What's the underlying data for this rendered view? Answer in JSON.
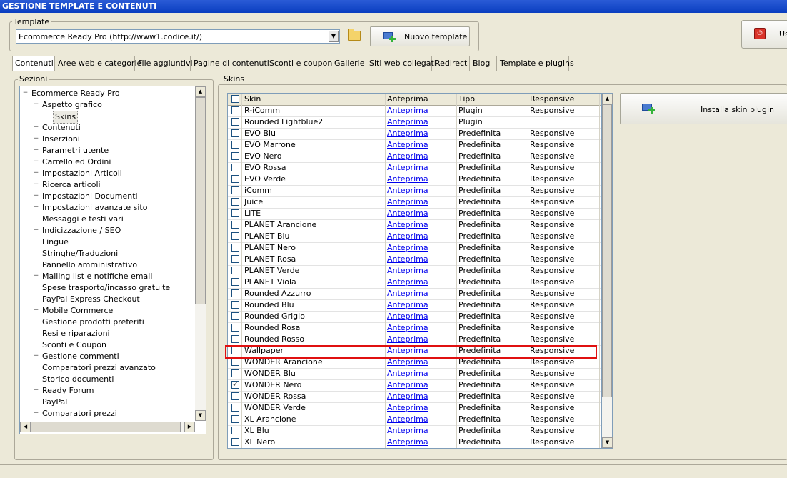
{
  "window": {
    "title": "GESTIONE TEMPLATE E CONTENUTI"
  },
  "template": {
    "group_label": "Template",
    "selected": "Ecommerce Ready Pro (http://www1.codice.it/)",
    "new_button": "Nuovo template"
  },
  "corner_button": "Us",
  "tabs": [
    "Contenuti",
    "Aree web e categorie",
    "File aggiuntivi",
    "Pagine di contenuti",
    "Sconti e coupon",
    "Gallerie",
    "Siti web collegati",
    "Redirect",
    "Blog",
    "Template e plugins"
  ],
  "sections": {
    "label": "Sezioni",
    "root": "Ecommerce Ready Pro",
    "items": [
      {
        "label": "Aspetto grafico",
        "level": 1,
        "expander": "−"
      },
      {
        "label": "Skins",
        "level": 2,
        "expander": ""
      },
      {
        "label": "Contenuti",
        "level": 1,
        "expander": "+"
      },
      {
        "label": "Inserzioni",
        "level": 1,
        "expander": "+"
      },
      {
        "label": "Parametri utente",
        "level": 1,
        "expander": "+"
      },
      {
        "label": "Carrello ed Ordini",
        "level": 1,
        "expander": "+"
      },
      {
        "label": "Impostazioni Articoli",
        "level": 1,
        "expander": "+"
      },
      {
        "label": "Ricerca articoli",
        "level": 1,
        "expander": "+"
      },
      {
        "label": "Impostazioni Documenti",
        "level": 1,
        "expander": "+"
      },
      {
        "label": "Impostazioni avanzate sito",
        "level": 1,
        "expander": "+"
      },
      {
        "label": "Messaggi e testi vari",
        "level": 1,
        "expander": ""
      },
      {
        "label": "Indicizzazione / SEO",
        "level": 1,
        "expander": "+"
      },
      {
        "label": "Lingue",
        "level": 1,
        "expander": ""
      },
      {
        "label": "Stringhe/Traduzioni",
        "level": 1,
        "expander": ""
      },
      {
        "label": "Pannello amministrativo",
        "level": 1,
        "expander": ""
      },
      {
        "label": "Mailing list e notifiche email",
        "level": 1,
        "expander": "+"
      },
      {
        "label": "Spese trasporto/incasso gratuite",
        "level": 1,
        "expander": ""
      },
      {
        "label": "PayPal Express Checkout",
        "level": 1,
        "expander": ""
      },
      {
        "label": "Mobile Commerce",
        "level": 1,
        "expander": "+"
      },
      {
        "label": "Gestione prodotti preferiti",
        "level": 1,
        "expander": ""
      },
      {
        "label": "Resi e riparazioni",
        "level": 1,
        "expander": ""
      },
      {
        "label": "Sconti e Coupon",
        "level": 1,
        "expander": ""
      },
      {
        "label": "Gestione commenti",
        "level": 1,
        "expander": "+"
      },
      {
        "label": "Comparatori prezzi avanzato",
        "level": 1,
        "expander": ""
      },
      {
        "label": "Storico documenti",
        "level": 1,
        "expander": ""
      },
      {
        "label": "Ready Forum",
        "level": 1,
        "expander": "+"
      },
      {
        "label": "PayPal",
        "level": 1,
        "expander": ""
      },
      {
        "label": "Comparatori prezzi",
        "level": 1,
        "expander": "+"
      }
    ]
  },
  "skins": {
    "label": "Skins",
    "columns": [
      "Skin",
      "Anteprima",
      "Tipo",
      "Responsive"
    ],
    "preview_link": "Anteprima",
    "install_button": "Installa skin plugin",
    "rows": [
      {
        "name": "R-iComm",
        "type": "Plugin",
        "responsive": "Responsive",
        "checked": false
      },
      {
        "name": "Rounded Lightblue2",
        "type": "Plugin",
        "responsive": "",
        "checked": false
      },
      {
        "name": "EVO Blu",
        "type": "Predefinita",
        "responsive": "Responsive",
        "checked": false
      },
      {
        "name": "EVO Marrone",
        "type": "Predefinita",
        "responsive": "Responsive",
        "checked": false
      },
      {
        "name": "EVO Nero",
        "type": "Predefinita",
        "responsive": "Responsive",
        "checked": false
      },
      {
        "name": "EVO Rossa",
        "type": "Predefinita",
        "responsive": "Responsive",
        "checked": false
      },
      {
        "name": "EVO Verde",
        "type": "Predefinita",
        "responsive": "Responsive",
        "checked": false
      },
      {
        "name": "iComm",
        "type": "Predefinita",
        "responsive": "Responsive",
        "checked": false
      },
      {
        "name": "Juice",
        "type": "Predefinita",
        "responsive": "Responsive",
        "checked": false
      },
      {
        "name": "LITE",
        "type": "Predefinita",
        "responsive": "Responsive",
        "checked": false
      },
      {
        "name": "PLANET Arancione",
        "type": "Predefinita",
        "responsive": "Responsive",
        "checked": false
      },
      {
        "name": "PLANET Blu",
        "type": "Predefinita",
        "responsive": "Responsive",
        "checked": false
      },
      {
        "name": "PLANET Nero",
        "type": "Predefinita",
        "responsive": "Responsive",
        "checked": false
      },
      {
        "name": "PLANET Rosa",
        "type": "Predefinita",
        "responsive": "Responsive",
        "checked": false
      },
      {
        "name": "PLANET Verde",
        "type": "Predefinita",
        "responsive": "Responsive",
        "checked": false
      },
      {
        "name": "PLANET Viola",
        "type": "Predefinita",
        "responsive": "Responsive",
        "checked": false
      },
      {
        "name": "Rounded Azzurro",
        "type": "Predefinita",
        "responsive": "Responsive",
        "checked": false
      },
      {
        "name": "Rounded Blu",
        "type": "Predefinita",
        "responsive": "Responsive",
        "checked": false
      },
      {
        "name": "Rounded Grigio",
        "type": "Predefinita",
        "responsive": "Responsive",
        "checked": false
      },
      {
        "name": "Rounded Rosa",
        "type": "Predefinita",
        "responsive": "Responsive",
        "checked": false
      },
      {
        "name": "Rounded Rosso",
        "type": "Predefinita",
        "responsive": "Responsive",
        "checked": false
      },
      {
        "name": "Wallpaper",
        "type": "Predefinita",
        "responsive": "Responsive",
        "checked": false
      },
      {
        "name": "WONDER Arancione",
        "type": "Predefinita",
        "responsive": "Responsive",
        "checked": false
      },
      {
        "name": "WONDER Blu",
        "type": "Predefinita",
        "responsive": "Responsive",
        "checked": false
      },
      {
        "name": "WONDER Nero",
        "type": "Predefinita",
        "responsive": "Responsive",
        "checked": true
      },
      {
        "name": "WONDER Rossa",
        "type": "Predefinita",
        "responsive": "Responsive",
        "checked": false
      },
      {
        "name": "WONDER Verde",
        "type": "Predefinita",
        "responsive": "Responsive",
        "checked": false
      },
      {
        "name": "XL Arancione",
        "type": "Predefinita",
        "responsive": "Responsive",
        "checked": false
      },
      {
        "name": "XL Blu",
        "type": "Predefinita",
        "responsive": "Responsive",
        "checked": false
      },
      {
        "name": "XL Nero",
        "type": "Predefinita",
        "responsive": "Responsive",
        "checked": false
      }
    ]
  }
}
